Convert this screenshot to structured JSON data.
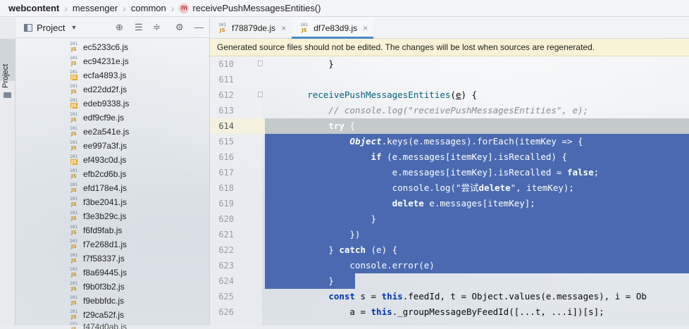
{
  "breadcrumb": {
    "items": [
      "webcontent",
      "messenger",
      "common",
      "receivePushMessagesEntities()"
    ],
    "method_badge": "m"
  },
  "sidestripe": {
    "label": "Project"
  },
  "project_panel": {
    "title": "Project",
    "files": [
      {
        "name": "ec5233c6.js",
        "icon": "js"
      },
      {
        "name": "ec94231e.js",
        "icon": "js"
      },
      {
        "name": "ecfa4893.js",
        "icon": "js-doc"
      },
      {
        "name": "ed22dd2f.js",
        "icon": "js"
      },
      {
        "name": "edeb9338.js",
        "icon": "js-doc"
      },
      {
        "name": "edf9cf9e.js",
        "icon": "js"
      },
      {
        "name": "ee2a541e.js",
        "icon": "js"
      },
      {
        "name": "ee997a3f.js",
        "icon": "js"
      },
      {
        "name": "ef493c0d.js",
        "icon": "js-doc"
      },
      {
        "name": "efb2cd6b.js",
        "icon": "js"
      },
      {
        "name": "efd178e4.js",
        "icon": "js"
      },
      {
        "name": "f3be2041.js",
        "icon": "js"
      },
      {
        "name": "f3e3b29c.js",
        "icon": "js"
      },
      {
        "name": "f6fd9fab.js",
        "icon": "js"
      },
      {
        "name": "f7e268d1.js",
        "icon": "js"
      },
      {
        "name": "f7f58337.js",
        "icon": "js"
      },
      {
        "name": "f8a69445.js",
        "icon": "js"
      },
      {
        "name": "f9b0f3b2.js",
        "icon": "js"
      },
      {
        "name": "f9ebbfdc.js",
        "icon": "js"
      },
      {
        "name": "f29ca52f.js",
        "icon": "js"
      }
    ],
    "partial_file": "f474d0ab.js"
  },
  "editor": {
    "tabs": [
      {
        "label": "f78879de.js",
        "active": false
      },
      {
        "label": "df7e83d9.js",
        "active": true
      }
    ],
    "warning": "Generated source files should not be edited. The changes will be lost when sources are regenerated.",
    "caret_line": 614,
    "selected_lines": [
      614,
      624
    ],
    "lines": [
      {
        "num": "610",
        "text": "            }"
      },
      {
        "num": "611",
        "text": ""
      },
      {
        "num": "612",
        "text": "        receivePushMessagesEntities(e) {"
      },
      {
        "num": "613",
        "text": "            // console.log(\"receivePushMessagesEntities\", e);"
      },
      {
        "num": "614",
        "text": "            try {"
      },
      {
        "num": "615",
        "text": "                Object.keys(e.messages).forEach(itemKey => {"
      },
      {
        "num": "616",
        "text": "                    if (e.messages[itemKey].isRecalled) {"
      },
      {
        "num": "617",
        "text": "                        e.messages[itemKey].isRecalled = false;"
      },
      {
        "num": "618",
        "text": "                        console.log(\"尝试delete\", itemKey);"
      },
      {
        "num": "619",
        "text": "                        delete e.messages[itemKey];"
      },
      {
        "num": "620",
        "text": "                    }"
      },
      {
        "num": "621",
        "text": "                })"
      },
      {
        "num": "622",
        "text": "            } catch (e) {"
      },
      {
        "num": "623",
        "text": "                console.error(e)"
      },
      {
        "num": "624",
        "text": "            }"
      },
      {
        "num": "625",
        "text": "            const s = this.feedId, t = Object.values(e.messages), i = Ob"
      },
      {
        "num": "626",
        "text": "                a = this._groupMessageByFeedId([...t, ...i])[s];"
      }
    ]
  },
  "colors": {
    "selection": "#4a69b0",
    "keyword": "#0033b3",
    "method": "#00627a",
    "comment": "#8c8c8c",
    "string": "#067d17",
    "warning_bg": "#f7f1d6",
    "active_tab_underline": "#4a88c7"
  },
  "icons": [
    "method-icon",
    "project-icon",
    "target-icon",
    "expand-all-icon",
    "collapse-all-icon",
    "gear-icon",
    "hide-icon",
    "js-file-icon",
    "close-icon",
    "fold-icon"
  ]
}
